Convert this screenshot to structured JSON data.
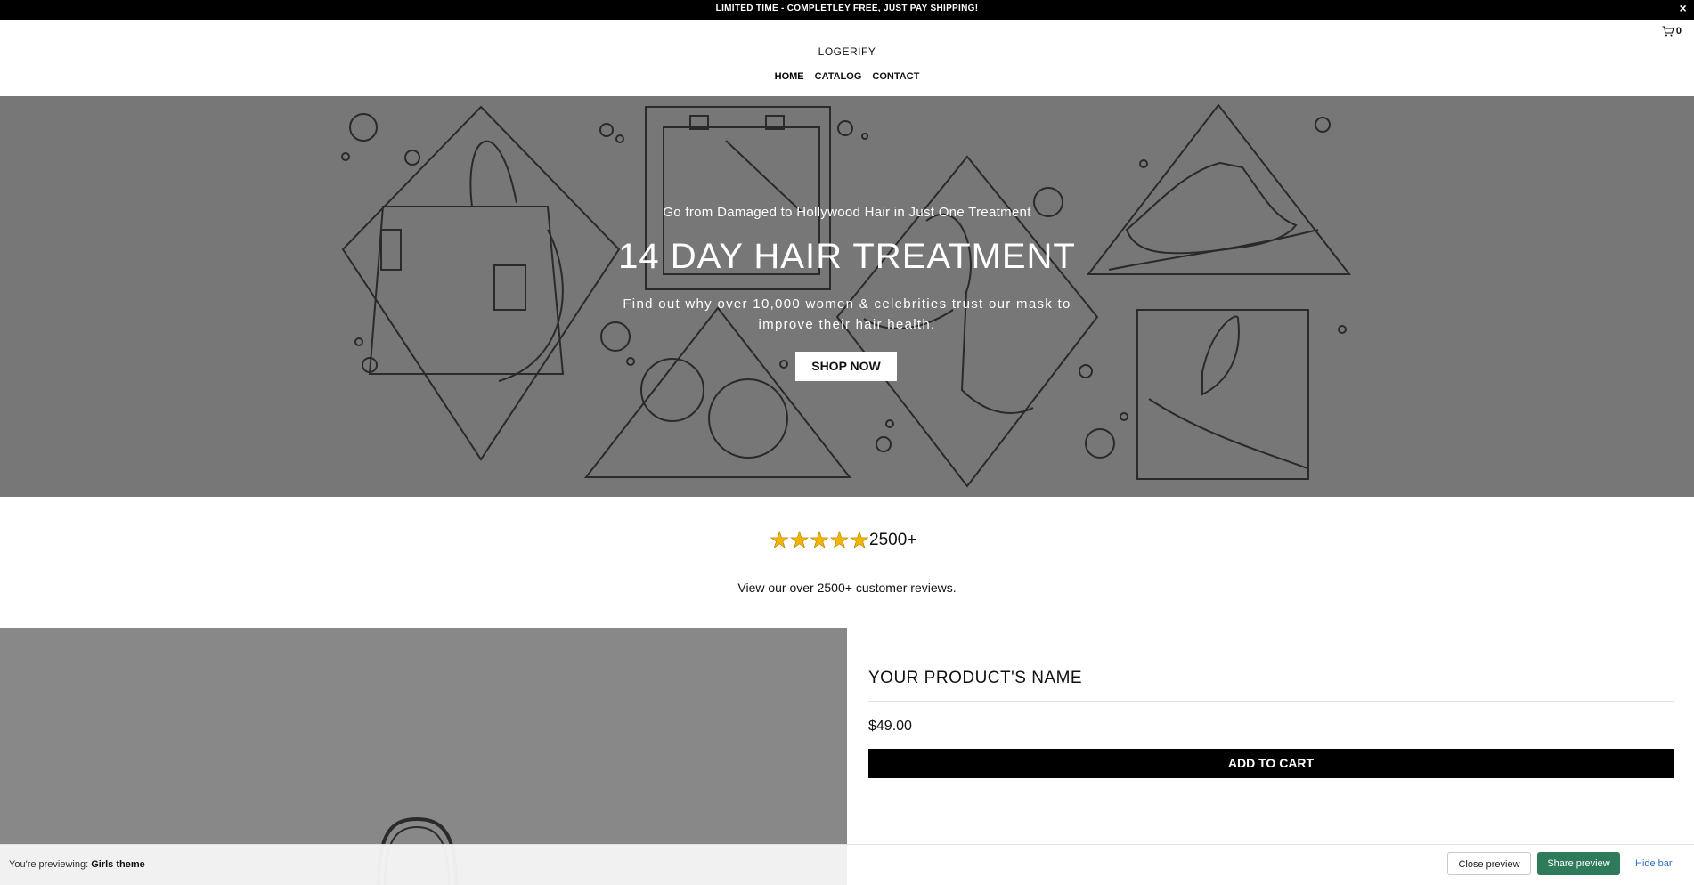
{
  "announcement": {
    "text": "LIMITED TIME - COMPLETLEY FREE, JUST PAY SHIPPING!",
    "close": "×"
  },
  "header": {
    "brand": "LOGERIFY",
    "cart_count": "0",
    "nav": [
      {
        "label": "HOME",
        "active": true
      },
      {
        "label": "CATALOG",
        "active": false
      },
      {
        "label": "CONTACT",
        "active": false
      }
    ]
  },
  "hero": {
    "subtitle": "Go from Damaged to Hollywood Hair in Just One Treatment",
    "title": "14 DAY HAIR TREATMENT",
    "description_line1": "Find out why over 10,000 women & celebrities trust our mask to",
    "description_line2": "improve their hair health.",
    "button": "SHOP NOW",
    "background": "#777777"
  },
  "reviews": {
    "rating": 5,
    "stars": "★★★★★",
    "count": "2500+",
    "text": "View our over 2500+ customer reviews."
  },
  "product": {
    "name": "YOUR PRODUCT'S NAME",
    "price": "$49.00",
    "add_to_cart": "ADD TO CART"
  },
  "preview_bar": {
    "label": "You're previewing:",
    "theme": "Girls theme",
    "close_preview": "Close preview",
    "share_preview": "Share preview",
    "hide_bar": "Hide bar",
    "accent": "#2f7a5b",
    "link_color": "#2c6ecb"
  },
  "icons": {
    "cart": "shopping-cart-icon",
    "close": "close-icon",
    "star": "star-icon"
  }
}
